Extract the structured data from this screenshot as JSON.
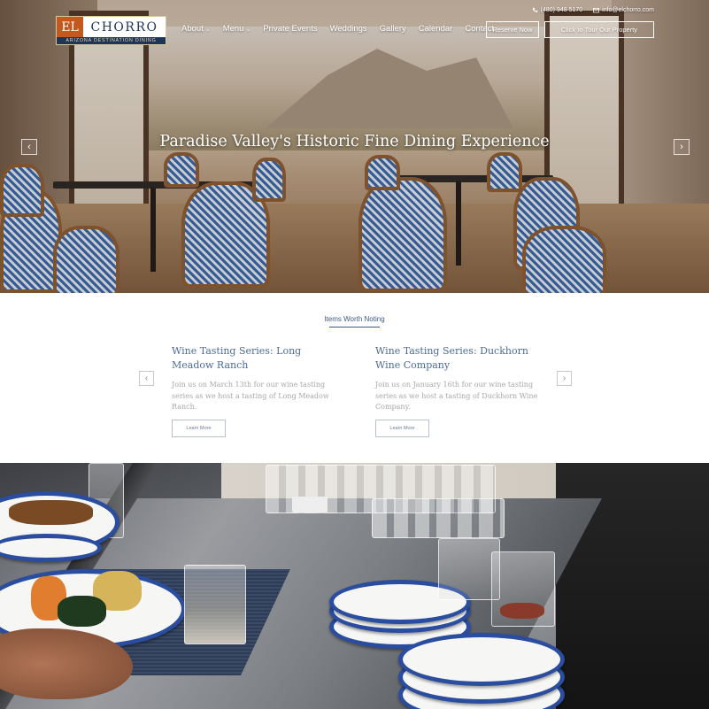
{
  "logo": {
    "el": "EL",
    "chorro": "CHORRO",
    "tagline": "ARIZONA DESTINATION DINING",
    "icon": "el-chorro-logo"
  },
  "contact": {
    "phone": "(480) 948 5170",
    "phone_icon": "phone-icon",
    "email": "info@elchorro.com",
    "email_icon": "mail-icon"
  },
  "nav": {
    "items": [
      {
        "label": "About",
        "dropdown": true
      },
      {
        "label": "Menu",
        "dropdown": true
      },
      {
        "label": "Private Events",
        "dropdown": false
      },
      {
        "label": "Weddings",
        "dropdown": false
      },
      {
        "label": "Gallery",
        "dropdown": false
      },
      {
        "label": "Calendar",
        "dropdown": false
      },
      {
        "label": "Contact",
        "dropdown": false
      }
    ],
    "reserve_label": "Reserve Now",
    "tour_label": "Click to Tour Our Property"
  },
  "hero": {
    "title": "Paradise Valley's Historic Fine Dining Experience",
    "prev_icon": "chevron-left-icon",
    "next_icon": "chevron-right-icon"
  },
  "notes": {
    "heading": "Items Worth Noting",
    "cards": [
      {
        "title": "Wine Tasting Series: Long Meadow Ranch",
        "body": "Join us on March 13th for our wine tasting series as we host a tasting of Long Meadow Ranch.",
        "button": "Learn More"
      },
      {
        "title": "Wine Tasting Series: Duckhorn Wine Company",
        "body": "Join us on January 16th for our wine tasting series as we host a tasting of Duckhorn Wine Company.",
        "button": "Learn More"
      }
    ]
  },
  "colors": {
    "brand_navy": "#1f3557",
    "brand_orange": "#c4581f",
    "link_blue": "#4a6c9b"
  }
}
